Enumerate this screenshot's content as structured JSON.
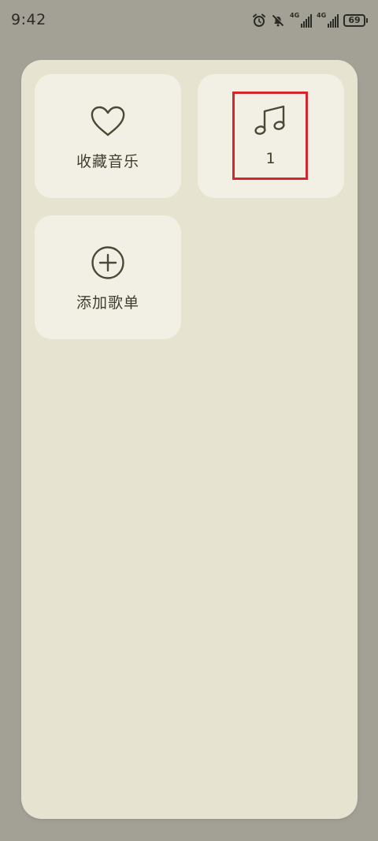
{
  "status_bar": {
    "time": "9:42",
    "battery_level": "69",
    "network_labels": [
      "4G",
      "4G"
    ]
  },
  "tiles": [
    {
      "label": "收藏音乐",
      "icon": "heart-icon"
    },
    {
      "label": "1",
      "icon": "music-note-icon"
    },
    {
      "label": "添加歌单",
      "icon": "plus-circle-icon"
    }
  ],
  "colors": {
    "screen_background": "#a3a196",
    "panel_background": "#e6e4d1",
    "tile_background": "#f2f0e4",
    "icon_text": "#4a4a34",
    "highlight": "#d4272d"
  }
}
